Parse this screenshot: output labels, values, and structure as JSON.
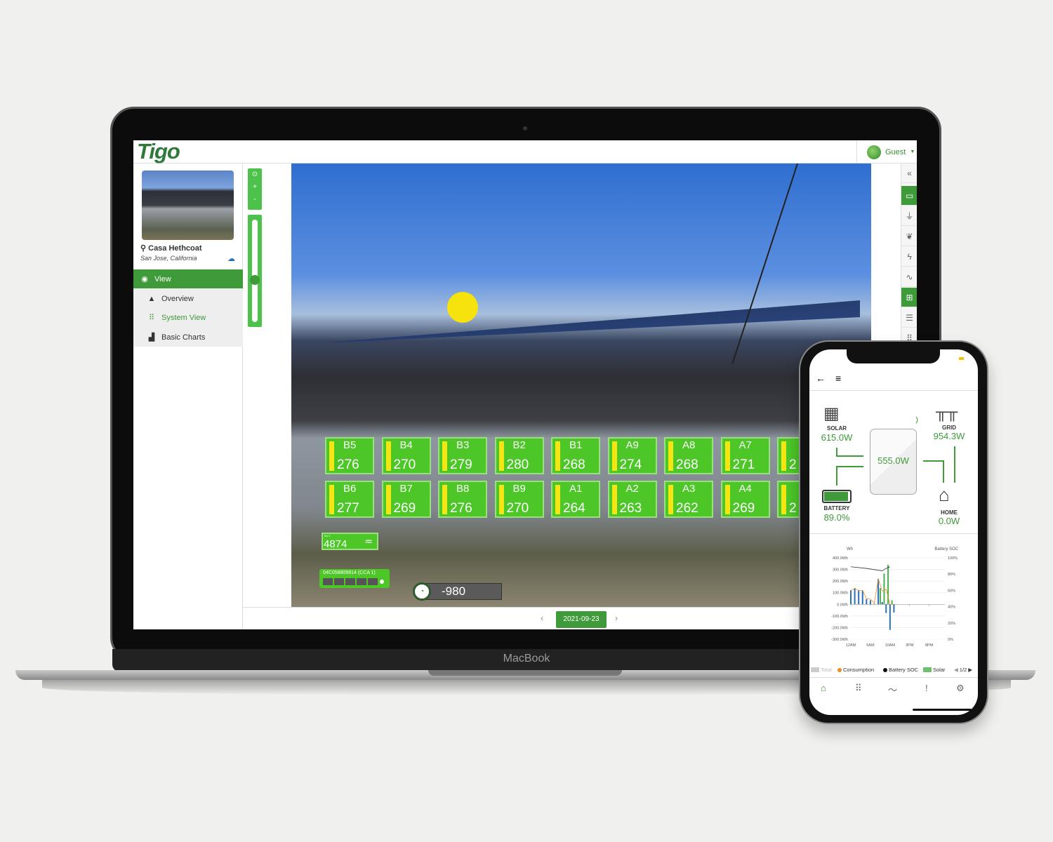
{
  "device": {
    "laptop_label": "MacBook"
  },
  "app": {
    "logo": "Tigo",
    "user": "Guest",
    "site": {
      "name": "Casa Hethcoat",
      "location": "San Jose, California"
    },
    "menu": [
      {
        "label": "View",
        "icon": "eye-icon"
      },
      {
        "label": "Overview",
        "icon": "triangle-icon"
      },
      {
        "label": "System View",
        "icon": "grid-icon"
      },
      {
        "label": "Basic Charts",
        "icon": "bar-chart-icon"
      }
    ],
    "zoom": {
      "center": "⊙",
      "plus": "+",
      "minus": "-",
      "level_percent": 40
    },
    "panels_row1": [
      {
        "id": "B5",
        "v": "276"
      },
      {
        "id": "B4",
        "v": "270"
      },
      {
        "id": "B3",
        "v": "279"
      },
      {
        "id": "B2",
        "v": "280"
      },
      {
        "id": "B1",
        "v": "268"
      },
      {
        "id": "A9",
        "v": "274"
      },
      {
        "id": "A8",
        "v": "268"
      },
      {
        "id": "A7",
        "v": "271"
      },
      {
        "id": "",
        "v": "2"
      }
    ],
    "panels_row2": [
      {
        "id": "B6",
        "v": "277"
      },
      {
        "id": "B7",
        "v": "269"
      },
      {
        "id": "B8",
        "v": "276"
      },
      {
        "id": "B9",
        "v": "270"
      },
      {
        "id": "A1",
        "v": "264"
      },
      {
        "id": "A2",
        "v": "263"
      },
      {
        "id": "A3",
        "v": "262"
      },
      {
        "id": "A4",
        "v": "269"
      },
      {
        "id": "",
        "v": "2"
      }
    ],
    "inverter": {
      "label": "Inv 1",
      "value": "4874"
    },
    "cca": {
      "label": "04C058809814 (CCA 1)"
    },
    "meter": {
      "value": "-980"
    },
    "date": "2021-09-23",
    "collapse": "«",
    "colors": {
      "accent": "#3f9a3a",
      "panel": "#4cc727",
      "panel_bar": "#f4e513"
    }
  },
  "phone": {
    "solar": {
      "label": "SOLAR",
      "value": "615.0W"
    },
    "grid": {
      "label": "GRID",
      "value": "954.3W"
    },
    "inverter": {
      "value": "555.0W"
    },
    "battery": {
      "label": "BATTERY",
      "value": "89.0%",
      "level": 0.89
    },
    "home": {
      "label": "HOME",
      "value": "0.0W"
    },
    "legend": [
      {
        "label": "Total",
        "color": "#cccccc"
      },
      {
        "label": "Consumption",
        "color": "#f08a24"
      },
      {
        "label": "Battery SOC",
        "color": "#111111"
      },
      {
        "label": "Solar",
        "color": "#6cc070"
      }
    ],
    "legend_page": "1/2"
  },
  "chart_data": {
    "type": "bar",
    "ylabel": "Wh",
    "y2label": "Battery SOC",
    "ylim": [
      -300,
      400
    ],
    "y2lim": [
      0,
      100
    ],
    "yticks": [
      "400.0Wh",
      "300.0Wh",
      "200.0Wh",
      "100.0Wh",
      "0.0Wh",
      "-100.0Wh",
      "-200.0Wh",
      "-300.0Wh"
    ],
    "y2ticks": [
      "100%",
      "80%",
      "60%",
      "40%",
      "20%",
      "0%"
    ],
    "xticks": [
      "12AM",
      "5AM",
      "10AM",
      "3PM",
      "8PM"
    ],
    "x_hours": [
      0,
      1,
      2,
      3,
      4,
      5,
      6,
      7,
      8,
      9,
      10,
      11
    ],
    "series": [
      {
        "color": "#2a6fb8",
        "values": [
          120,
          140,
          120,
          120,
          45,
          35,
          5,
          220,
          20,
          -75,
          -220,
          -70
        ]
      },
      {
        "name": "Solar",
        "color": "#4caf50",
        "values": [
          0,
          0,
          0,
          0,
          0,
          0,
          0,
          140,
          265,
          340,
          35,
          0
        ]
      },
      {
        "name": "Consumption",
        "type": "line",
        "color": "#f08a24",
        "values": [
          120,
          135,
          120,
          120,
          50,
          45,
          10,
          220,
          115,
          130,
          0,
          0
        ]
      },
      {
        "name": "Battery SOC",
        "type": "line",
        "axis": "right",
        "color": "#333333",
        "x_hours": [
          0,
          4,
          8,
          9,
          10
        ],
        "values": [
          89,
          87,
          84,
          87,
          89
        ]
      }
    ]
  }
}
